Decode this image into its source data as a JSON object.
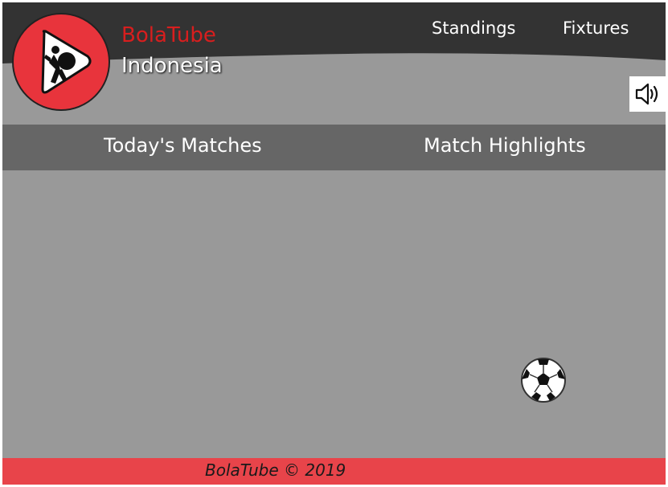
{
  "brand": {
    "name": "BolaTube",
    "country": "Indonesia",
    "logo_icon": "play-soccer-player-icon"
  },
  "top_nav": {
    "standings_label": "Standings",
    "fixtures_label": "Fixtures"
  },
  "sound": {
    "icon": "speaker-volume-icon"
  },
  "tabs": {
    "today_label": "Today's Matches",
    "highlights_label": "Match Highlights"
  },
  "main": {
    "ball_icon": "soccer-ball-icon"
  },
  "footer": {
    "text": "BolaTube © 2019"
  },
  "colors": {
    "header_dark": "#333333",
    "body_gray": "#999999",
    "tabs_gray": "#666666",
    "brand_red": "#e8343c",
    "footer_red": "#e8444a"
  }
}
